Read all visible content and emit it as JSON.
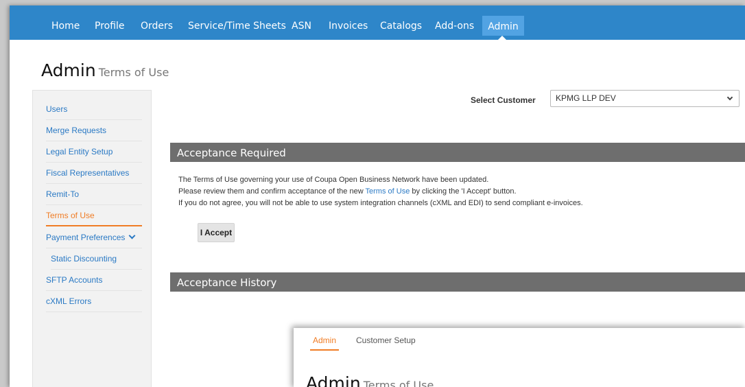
{
  "topnav": {
    "items": [
      "Home",
      "Profile",
      "Orders",
      "Service/Time Sheets",
      "ASN",
      "Invoices",
      "Catalogs",
      "Add-ons"
    ],
    "active": "Admin"
  },
  "page": {
    "title": "Admin",
    "subtitle": "Terms of Use"
  },
  "sidebar": {
    "items": [
      {
        "label": "Users"
      },
      {
        "label": "Merge Requests"
      },
      {
        "label": "Legal Entity Setup"
      },
      {
        "label": "Fiscal Representatives"
      },
      {
        "label": "Remit-To"
      },
      {
        "label": "Terms of Use"
      },
      {
        "label": "Payment Preferences"
      },
      {
        "label": "Static Discounting"
      },
      {
        "label": "SFTP Accounts"
      },
      {
        "label": "cXML Errors"
      }
    ],
    "active": "Terms of Use"
  },
  "customer_select": {
    "label": "Select Customer",
    "value": "KPMG LLP DEV"
  },
  "acceptance_required": {
    "header": "Acceptance Required",
    "line1": "The Terms of Use governing your use of Coupa Open Business Network have been updated.",
    "line2_pre": "Please review them and confirm acceptance of the new ",
    "line2_link": "Terms of Use",
    "line2_post": " by clicking the 'I Accept' button.",
    "line3": "If you do not agree, you will not be able to use system integration channels (cXML and EDI) to send compliant e-invoices.",
    "button": "I Accept"
  },
  "acceptance_history": {
    "header": "Acceptance History"
  },
  "second_screen": {
    "tabs": [
      "Admin",
      "Customer Setup"
    ],
    "title": "Admin",
    "subtitle": "Terms of Use"
  },
  "colors": {
    "nav": "#2e86c9",
    "nav_active": "#52a3e3",
    "link": "#2a79c4",
    "active_orange": "#f07c24",
    "panel_header": "#6e6e6e"
  }
}
